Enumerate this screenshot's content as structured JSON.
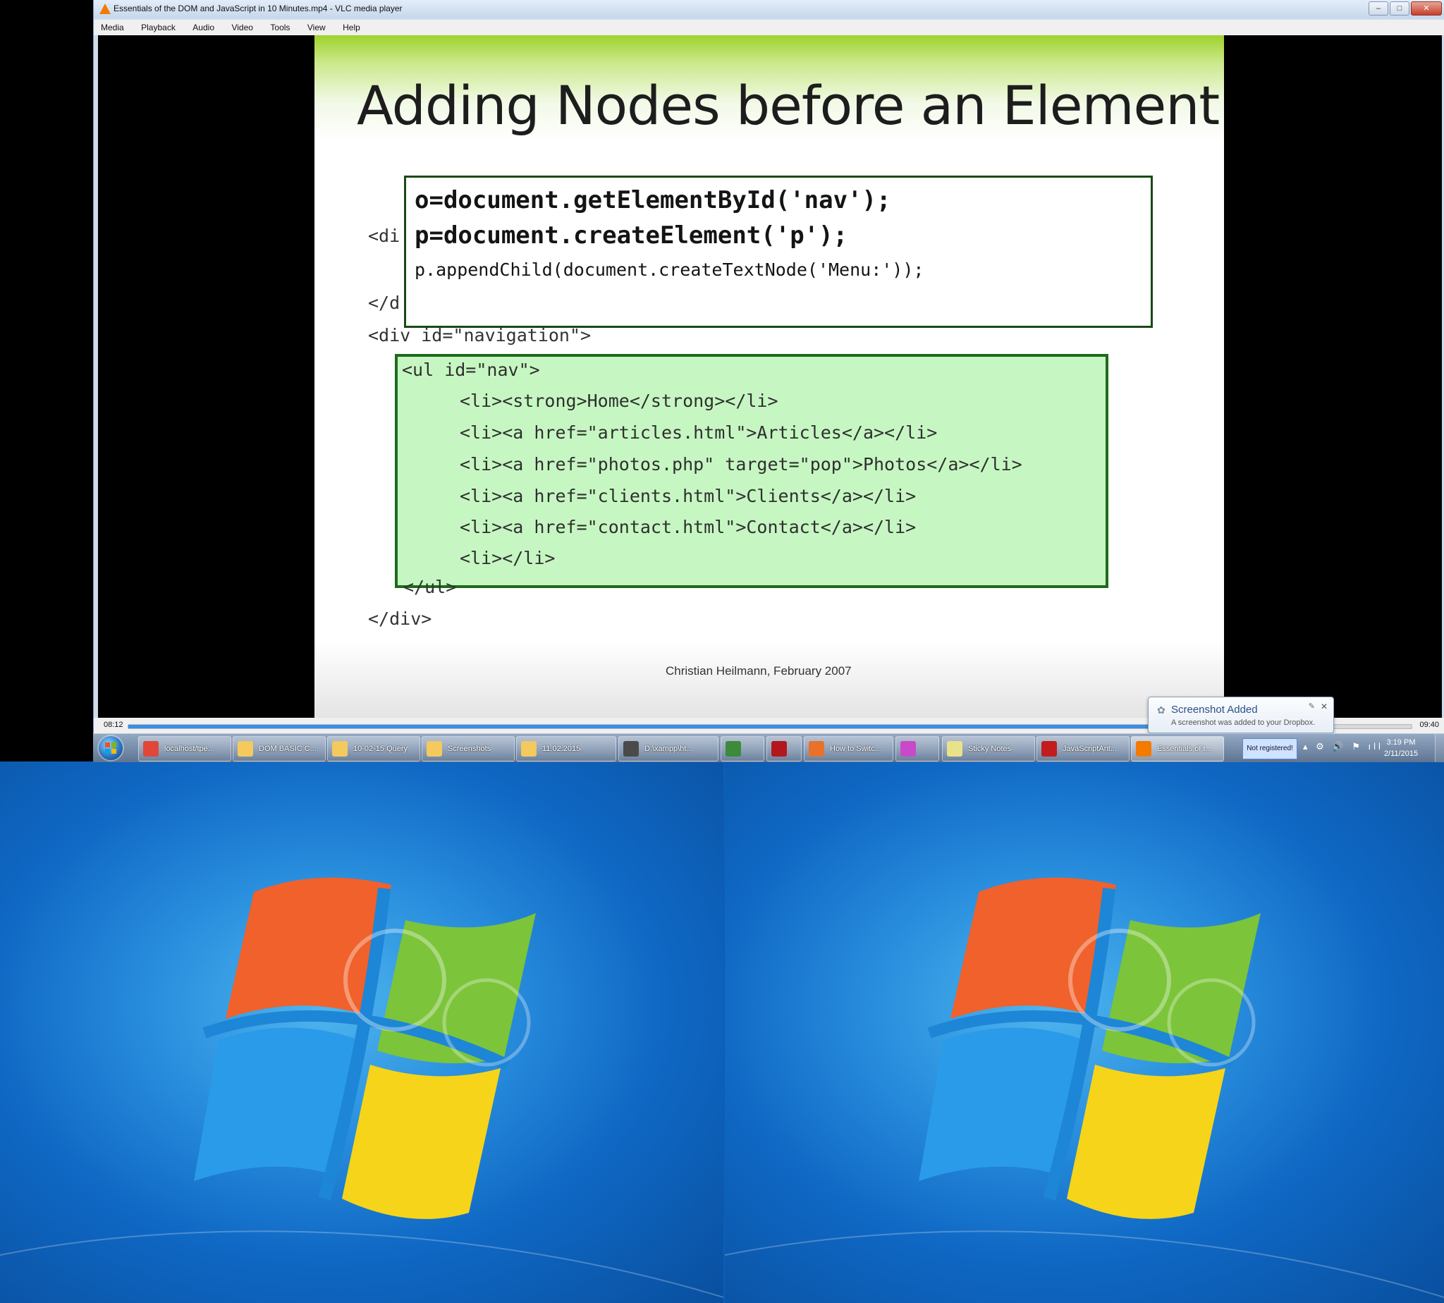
{
  "window": {
    "title": "Essentials of the DOM and JavaScript in 10 Minutes.mp4 - VLC media player",
    "minimize": "–",
    "maximize": "□",
    "close": "✕"
  },
  "menu": [
    "Media",
    "Playback",
    "Audio",
    "Video",
    "Tools",
    "View",
    "Help"
  ],
  "slide": {
    "title": "Adding Nodes before an Element",
    "behind_lines": [
      "<di",
      "</d",
      "<div id=\"navigation\">"
    ],
    "popup_code": [
      "o=document.getElementById('nav');",
      "p=document.createElement('p');",
      "p.appendChild(document.createTextNode('Menu:'));"
    ],
    "list_code": [
      "<ul id=\"nav\">",
      "<li><strong>Home</strong></li>",
      "<li><a href=\"articles.html\">Articles</a></li>",
      "<li><a href=\"photos.php\" target=\"pop\">Photos</a></li>",
      "<li><a href=\"clients.html\">Clients</a></li>",
      "<li><a href=\"contact.html\">Contact</a></li>",
      "<li></li>"
    ],
    "closing_lines": [
      "</ul>",
      "</div>"
    ],
    "credit": "Christian Heilmann, February 2007"
  },
  "playback": {
    "elapsed": "08:12",
    "total": "09:40",
    "progress": 0.849
  },
  "toast": {
    "title": "Screenshot Added",
    "message": "A screenshot was added to your Dropbox."
  },
  "taskbar": {
    "items": [
      {
        "label": "localhost/tpe...",
        "icon": "chrome-icon",
        "color": "#e0463a"
      },
      {
        "label": "DOM BASIC C...",
        "icon": "folder-icon",
        "color": "#f4c95d"
      },
      {
        "label": "10-02-15 Query",
        "icon": "folder-icon",
        "color": "#f4c95d"
      },
      {
        "label": "Screenshots",
        "icon": "folder-icon",
        "color": "#f4c95d"
      },
      {
        "label": "11.02.2015",
        "icon": "folder-icon",
        "color": "#f4c95d"
      },
      {
        "label": "D:\\xampp\\ht...",
        "icon": "sublime-icon",
        "color": "#4a4a4a"
      },
      {
        "label": "",
        "icon": "media-icon",
        "color": "#3c8a3c"
      },
      {
        "label": "",
        "icon": "filezilla-icon",
        "color": "#b3171c"
      },
      {
        "label": "How to Switc...",
        "icon": "firefox-icon",
        "color": "#e8722a"
      },
      {
        "label": "",
        "icon": "pinwheel-icon",
        "color": "#c84ac8"
      },
      {
        "label": "Sticky Notes",
        "icon": "sticky-notes-icon",
        "color": "#e8e28a"
      },
      {
        "label": "JavaScriptAnt...",
        "icon": "pdf-icon",
        "color": "#c21c1c"
      },
      {
        "label": "Essentials of t...",
        "icon": "vlc-icon",
        "color": "#f27b00"
      }
    ],
    "not_registered": "Not registered!",
    "tray_icons": "▴ ⚙ 🔊 ⚑ ıll",
    "time": "3:19 PM",
    "date": "2/11/2015"
  }
}
